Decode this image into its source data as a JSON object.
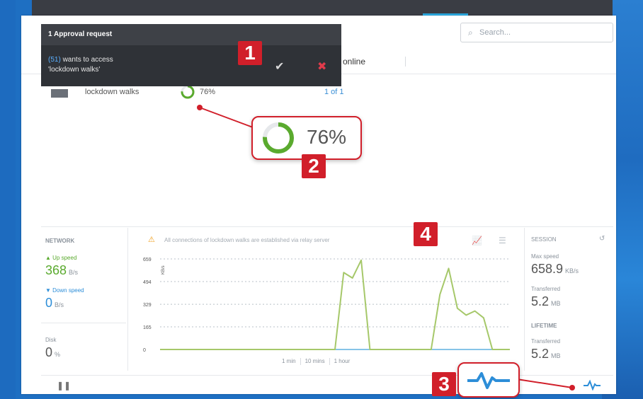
{
  "search": {
    "placeholder": "Search..."
  },
  "popup": {
    "title": "1 Approval request",
    "requester": "(51)",
    "message_rest": " wants to access",
    "message_line2": "'lockdown walks'",
    "accept_icon": "check-icon",
    "reject_icon": "close-icon"
  },
  "tabs": {
    "online": "online"
  },
  "share_row": {
    "name": "lockdown walks",
    "progress_percent": 76,
    "progress_label": "76%",
    "pages": "1 of 1"
  },
  "zoom": {
    "progress_label": "76%"
  },
  "badges": {
    "b1": "1",
    "b2": "2",
    "b3": "3",
    "b4": "4"
  },
  "network": {
    "title": "NETWORK",
    "up_label": "▲ Up speed",
    "up_value": "368",
    "up_unit": "B/s",
    "down_label": "▼ Down speed",
    "down_value": "0",
    "down_unit": "B/s",
    "disk_label": "Disk",
    "disk_value": "0",
    "disk_unit": "%"
  },
  "chart_warning": "All connections of lockdown walks are established via relay server",
  "time_ranges": [
    "1 min",
    "10 mins",
    "1 hour"
  ],
  "session": {
    "title": "SESSION",
    "max_speed_label": "Max speed",
    "max_speed_value": "658.9",
    "max_speed_unit": "KB/s",
    "transferred_label": "Transferred",
    "transferred_value": "5.2",
    "transferred_unit": "MB"
  },
  "lifetime": {
    "title": "LIFETIME",
    "transferred_label": "Transferred",
    "transferred_value": "5.2",
    "transferred_unit": "MB"
  },
  "chart_data": {
    "type": "line",
    "ylabel": "KB/s",
    "yticks": [
      "659",
      "494",
      "329",
      "165",
      "0"
    ],
    "ylim": [
      0,
      659
    ],
    "x": [
      0,
      1,
      2,
      3,
      4,
      5,
      6,
      7,
      8,
      9,
      10,
      11,
      12,
      13,
      14,
      15,
      16,
      17,
      18,
      19,
      20,
      21,
      22,
      23,
      24,
      25,
      26,
      27,
      28,
      29,
      30,
      31,
      32,
      33,
      34,
      35,
      36,
      37,
      38,
      39,
      40
    ],
    "series": [
      {
        "values": [
          0,
          0,
          0,
          0,
          0,
          0,
          0,
          0,
          0,
          0,
          0,
          0,
          0,
          0,
          0,
          0,
          0,
          0,
          0,
          0,
          0,
          560,
          520,
          650,
          0,
          0,
          0,
          0,
          0,
          0,
          0,
          0,
          400,
          590,
          300,
          250,
          280,
          230,
          0,
          0,
          0
        ]
      }
    ],
    "grid": true,
    "line_color": "#a6c86a"
  },
  "colors": {
    "accent": "#2d8ed8",
    "badge": "#d11f2a",
    "progress": "#5aaa2e",
    "up": "#5aaa2e",
    "down": "#2d8ed8"
  }
}
